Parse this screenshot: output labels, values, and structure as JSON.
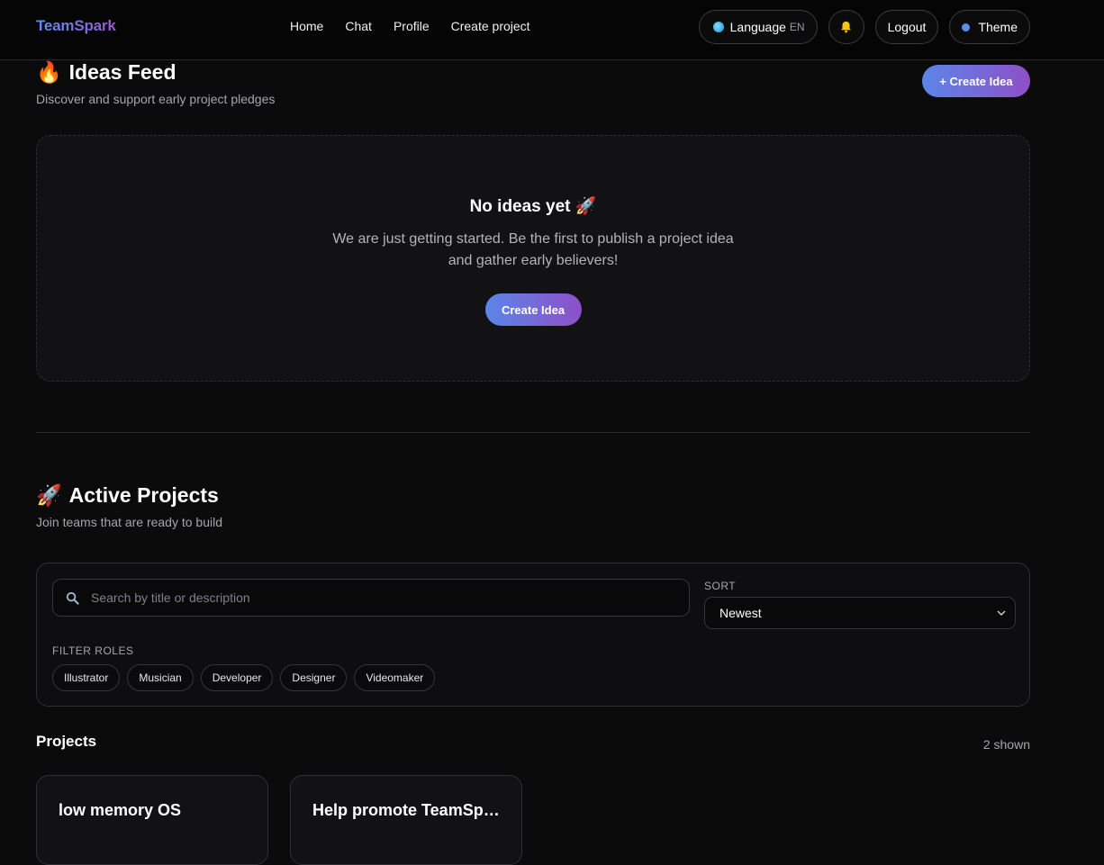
{
  "nav": {
    "brand": "TeamSpark",
    "links": [
      "Home",
      "Chat",
      "Profile",
      "Create project"
    ],
    "language_label": "Language",
    "language_code": "EN",
    "logout_label": "Logout",
    "theme_label": "Theme",
    "icons": {
      "language": "globe-icon",
      "notifications": "bell-icon",
      "theme": "dot-icon"
    }
  },
  "ideas": {
    "emoji": "🔥",
    "title": "Ideas Feed",
    "subtitle": "Discover and support early project pledges",
    "create_button": "+ Create Idea",
    "empty_title": "No ideas yet 🚀",
    "empty_text": "We are just getting started. Be the first to publish a project idea and gather early believers!",
    "empty_button": "Create Idea"
  },
  "active": {
    "emoji": "🚀",
    "title": "Active Projects",
    "subtitle": "Join teams that are ready to build",
    "search_placeholder": "Search by title or description",
    "sort_label": "SORT",
    "sort_value": "Newest",
    "filter_label": "FILTER ROLES",
    "roles": [
      "Illustrator",
      "Musician",
      "Developer",
      "Designer",
      "Videomaker"
    ]
  },
  "projects": {
    "title": "Projects",
    "shown": "2 shown",
    "items": [
      {
        "title": "low memory OS"
      },
      {
        "title": "Help promote TeamSpark"
      }
    ]
  },
  "colors": {
    "accent_start": "#5a86e8",
    "accent_end": "#8f4fc8",
    "background": "#0b0b0c"
  }
}
